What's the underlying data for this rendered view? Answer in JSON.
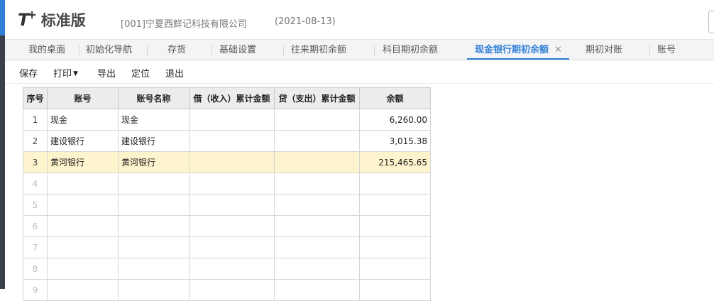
{
  "header": {
    "logo_mark": "T+",
    "logo_text": "标准版",
    "company": "[001]宁夏西鲜记科技有限公司",
    "date": "(2021-08-13)"
  },
  "tabs": [
    {
      "label": "我的桌面"
    },
    {
      "label": "初始化导航"
    },
    {
      "label": "存货"
    },
    {
      "label": "基础设置"
    },
    {
      "label": "往来期初余额"
    },
    {
      "label": "科目期初余额"
    },
    {
      "label": "现金银行期初余额",
      "active": true
    },
    {
      "label": "期初对账"
    },
    {
      "label": "账号"
    }
  ],
  "tab_close_glyph": "✕",
  "toolbar": {
    "save": "保存",
    "print": "打印",
    "export": "导出",
    "locate": "定位",
    "exit": "退出"
  },
  "table": {
    "columns": [
      "序号",
      "账号",
      "账号名称",
      "借（收入）累计金额",
      "贷（支出）累计金额",
      "余额"
    ],
    "rows": [
      {
        "seq": "1",
        "account": "现金",
        "name": "现金",
        "debit": "",
        "credit": "",
        "balance": "6,260.00"
      },
      {
        "seq": "2",
        "account": "建设银行",
        "name": "建设银行",
        "debit": "",
        "credit": "",
        "balance": "3,015.38"
      },
      {
        "seq": "3",
        "account": "黄河银行",
        "name": "黄河银行",
        "debit": "",
        "credit": "",
        "balance": "215,465.65"
      },
      {
        "seq": "4",
        "account": "",
        "name": "",
        "debit": "",
        "credit": "",
        "balance": ""
      },
      {
        "seq": "5",
        "account": "",
        "name": "",
        "debit": "",
        "credit": "",
        "balance": ""
      },
      {
        "seq": "6",
        "account": "",
        "name": "",
        "debit": "",
        "credit": "",
        "balance": ""
      },
      {
        "seq": "7",
        "account": "",
        "name": "",
        "debit": "",
        "credit": "",
        "balance": ""
      },
      {
        "seq": "8",
        "account": "",
        "name": "",
        "debit": "",
        "credit": "",
        "balance": ""
      },
      {
        "seq": "9",
        "account": "",
        "name": "",
        "debit": "",
        "credit": "",
        "balance": ""
      }
    ],
    "selected_row": 3
  },
  "colors": {
    "accent": "#2f7fd6",
    "selected_row": "#fdf4cd",
    "sidebar": "#3a3f4b"
  }
}
